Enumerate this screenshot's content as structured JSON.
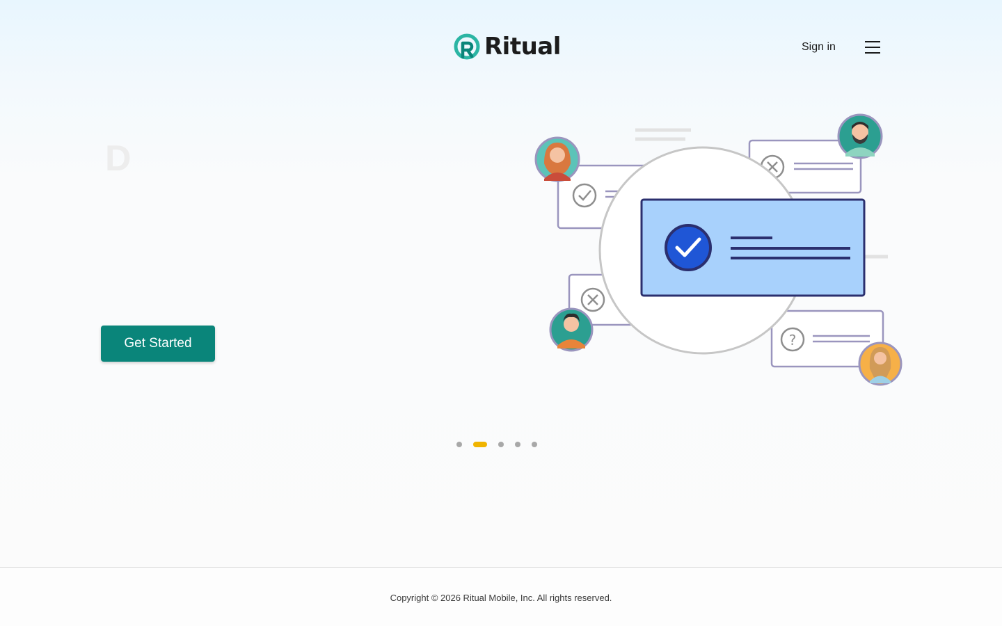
{
  "brand": {
    "name": "Ritual",
    "color": "#0a857a"
  },
  "header": {
    "signin_label": "Sign in",
    "menu_icon": "hamburger-icon"
  },
  "hero": {
    "partial_heading": "D",
    "cta_label": "Get Started",
    "illustration": {
      "selected_card_color": "#a8d1fc",
      "card_icons": [
        "check-icon",
        "x-icon",
        "x-icon",
        "question-icon"
      ]
    }
  },
  "carousel": {
    "total": 5,
    "active_index": 1,
    "active_color": "#f0b400"
  },
  "footer": {
    "copyright": "Copyright © 2026 Ritual Mobile, Inc. All rights reserved."
  }
}
